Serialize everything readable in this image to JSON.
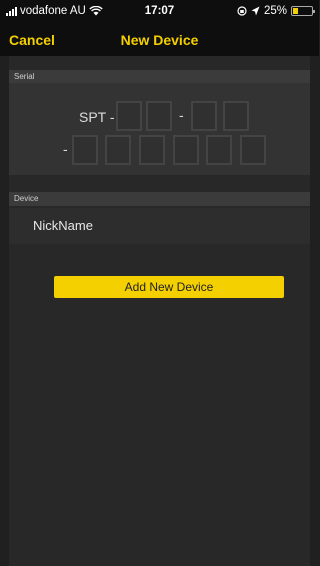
{
  "status_bar": {
    "carrier": "vodafone AU",
    "time": "17:07",
    "battery": "25%"
  },
  "nav": {
    "cancel_label": "Cancel",
    "title": "New Device"
  },
  "serial_section": {
    "header": "Serial",
    "prefix": "SPT -",
    "dash": "-",
    "fields_group1": 2,
    "fields_group2": 2,
    "fields_group3": 6
  },
  "device_section": {
    "header": "Device",
    "nickname_placeholder": "NickName"
  },
  "add_button_label": "Add New Device",
  "colors": {
    "accent": "#f5d000",
    "background": "#202020",
    "panel": "#333333"
  }
}
